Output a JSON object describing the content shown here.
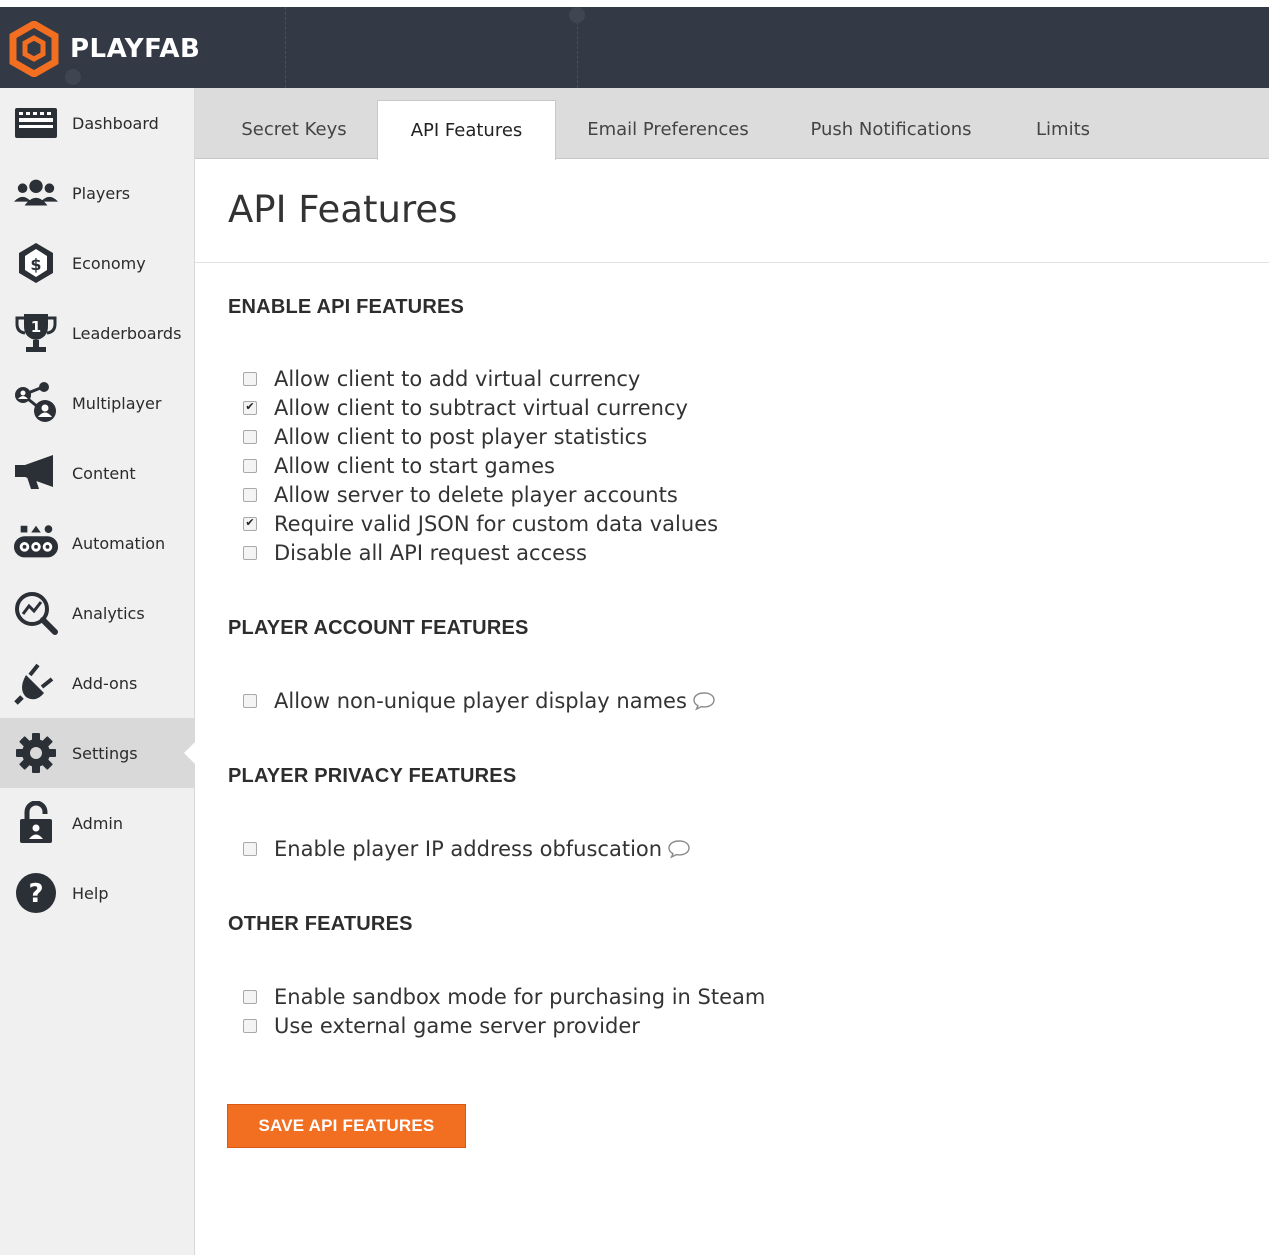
{
  "brand": {
    "name": "PLAYFAB",
    "accent": "#f26e21",
    "header_bg": "#333a45"
  },
  "sidebar": {
    "items": [
      {
        "label": "Dashboard",
        "icon": "dashboard-icon"
      },
      {
        "label": "Players",
        "icon": "players-icon"
      },
      {
        "label": "Economy",
        "icon": "economy-icon"
      },
      {
        "label": "Leaderboards",
        "icon": "leaderboards-icon"
      },
      {
        "label": "Multiplayer",
        "icon": "multiplayer-icon"
      },
      {
        "label": "Content",
        "icon": "megaphone-icon"
      },
      {
        "label": "Automation",
        "icon": "automation-icon"
      },
      {
        "label": "Analytics",
        "icon": "analytics-icon"
      },
      {
        "label": "Add-ons",
        "icon": "plug-icon"
      },
      {
        "label": "Settings",
        "icon": "gear-icon",
        "active": true
      },
      {
        "label": "Admin",
        "icon": "lock-icon"
      },
      {
        "label": "Help",
        "icon": "help-icon"
      }
    ]
  },
  "tabs": [
    {
      "label": "Secret Keys"
    },
    {
      "label": "API Features",
      "active": true
    },
    {
      "label": "Email Preferences"
    },
    {
      "label": "Push Notifications"
    },
    {
      "label": "Limits"
    }
  ],
  "page": {
    "title": "API Features"
  },
  "sections": {
    "enable_api": {
      "heading": "ENABLE API FEATURES",
      "options": [
        {
          "label": "Allow client to add virtual currency",
          "checked": false
        },
        {
          "label": "Allow client to subtract virtual currency",
          "checked": true
        },
        {
          "label": "Allow client to post player statistics",
          "checked": false
        },
        {
          "label": "Allow client to start games",
          "checked": false
        },
        {
          "label": "Allow server to delete player accounts",
          "checked": false
        },
        {
          "label": "Require valid JSON for custom data values",
          "checked": true
        },
        {
          "label": "Disable all API request access",
          "checked": false
        }
      ]
    },
    "player_account": {
      "heading": "PLAYER ACCOUNT FEATURES",
      "options": [
        {
          "label": "Allow non-unique player display names",
          "checked": false,
          "info": "comment-icon"
        }
      ]
    },
    "player_privacy": {
      "heading": "PLAYER PRIVACY FEATURES",
      "options": [
        {
          "label": "Enable player IP address obfuscation",
          "checked": false,
          "info": "comment-icon"
        }
      ]
    },
    "other": {
      "heading": "OTHER FEATURES",
      "options": [
        {
          "label": "Enable sandbox mode for purchasing in Steam",
          "checked": false
        },
        {
          "label": "Use external game server provider",
          "checked": false
        }
      ]
    }
  },
  "actions": {
    "save_label": "SAVE API FEATURES"
  }
}
